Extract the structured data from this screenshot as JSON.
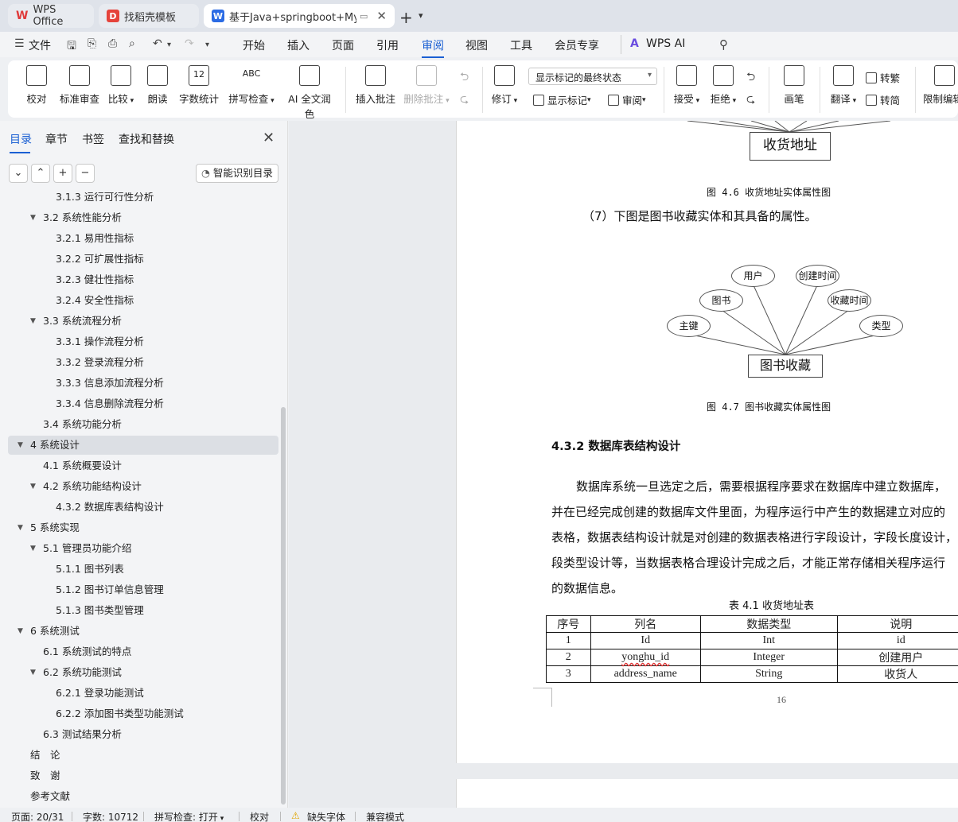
{
  "tabs": {
    "wps": "WPS Office",
    "template": "找稻壳模板",
    "document": "基于Java+springboot+MyS"
  },
  "menu": {
    "file": "文件",
    "items": [
      "开始",
      "插入",
      "页面",
      "引用",
      "审阅",
      "视图",
      "工具",
      "会员专享"
    ],
    "active": "审阅",
    "ai": "WPS AI"
  },
  "ribbon": {
    "proofread": "校对",
    "standard_review": "标准审查",
    "compare": "比较",
    "read_aloud": "朗读",
    "word_count": "字数统计",
    "spell_check": "拼写检查",
    "ai_polish": "AI 全文润色",
    "insert_comment": "插入批注",
    "delete_comment": "删除批注",
    "track_changes": "修订",
    "markup_mode": "显示标记的最终状态",
    "show_markup": "显示标记",
    "review": "审阅",
    "accept": "接受",
    "reject": "拒绝",
    "pen": "画笔",
    "translate": "翻译",
    "to_traditional": "转繁",
    "to_simplified": "转简",
    "restrict_edit": "限制编辑",
    "word_count_icon_text": "12",
    "spell_icon_text": "ABC"
  },
  "nav": {
    "tabs": [
      "目录",
      "章节",
      "书签",
      "查找和替换"
    ],
    "smart_toc": "智能识别目录",
    "toc": [
      {
        "label": "3.1.3 运行可行性分析",
        "level": 3
      },
      {
        "label": "3.2 系统性能分析",
        "level": 2,
        "expanded": true
      },
      {
        "label": "3.2.1 易用性指标",
        "level": 3
      },
      {
        "label": "3.2.2 可扩展性指标",
        "level": 3
      },
      {
        "label": "3.2.3 健壮性指标",
        "level": 3
      },
      {
        "label": "3.2.4 安全性指标",
        "level": 3
      },
      {
        "label": "3.3 系统流程分析",
        "level": 2,
        "expanded": true
      },
      {
        "label": "3.3.1 操作流程分析",
        "level": 3
      },
      {
        "label": "3.3.2 登录流程分析",
        "level": 3
      },
      {
        "label": "3.3.3 信息添加流程分析",
        "level": 3
      },
      {
        "label": "3.3.4 信息删除流程分析",
        "level": 3
      },
      {
        "label": "3.4 系统功能分析",
        "level": 2
      },
      {
        "label": "4 系统设计",
        "level": 1,
        "expanded": true,
        "selected": true
      },
      {
        "label": "4.1 系统概要设计",
        "level": 2
      },
      {
        "label": "4.2 系统功能结构设计",
        "level": 2,
        "expanded": true
      },
      {
        "label": "4.3.2 数据库表结构设计",
        "level": 3
      },
      {
        "label": "5 系统实现",
        "level": 1,
        "expanded": true
      },
      {
        "label": "5.1 管理员功能介绍",
        "level": 2,
        "expanded": true
      },
      {
        "label": "5.1.1 图书列表",
        "level": 3
      },
      {
        "label": "5.1.2 图书订单信息管理",
        "level": 3
      },
      {
        "label": "5.1.3 图书类型管理",
        "level": 3
      },
      {
        "label": "6 系统测试",
        "level": 1,
        "expanded": true
      },
      {
        "label": "6.1 系统测试的特点",
        "level": 2
      },
      {
        "label": "6.2 系统功能测试",
        "level": 2,
        "expanded": true
      },
      {
        "label": "6.2.1 登录功能测试",
        "level": 3
      },
      {
        "label": "6.2.2 添加图书类型功能测试",
        "level": 3
      },
      {
        "label": "6.3 测试结果分析",
        "level": 2
      },
      {
        "label": "结　论",
        "level": 1
      },
      {
        "label": "致　谢",
        "level": 1
      },
      {
        "label": "参考文献",
        "level": 1
      }
    ]
  },
  "document": {
    "entity_address": "收货地址",
    "fig_4_6": "图 4.6 收货地址实体属性图",
    "item7": "（7）下图是图书收藏实体和其具备的属性。",
    "entity_collect": "图书收藏",
    "attrs": [
      "用户",
      "创建时间",
      "图书",
      "收藏时间",
      "主键",
      "类型"
    ],
    "fig_4_7": "图 4.7 图书收藏实体属性图",
    "section_title": "4.3.2  数据库表结构设计",
    "paragraph_lines": [
      "数据库系统一旦选定之后，需要根据程序要求在数据库中建立数据库，",
      "并在已经完成创建的数据库文件里面，为程序运行中产生的数据建立对应的",
      "表格，数据表结构设计就是对创建的数据表格进行字段设计，字段长度设计，",
      "段类型设计等，当数据表格合理设计完成之后，才能正常存储相关程序运行",
      "的数据信息。"
    ],
    "table_title": "表 4.1 收货地址表",
    "table_header": [
      "序号",
      "列名",
      "数据类型",
      "说明"
    ],
    "table_rows": [
      [
        "1",
        "Id",
        "Int",
        "id"
      ],
      [
        "2",
        "yonghu_id",
        "Integer",
        "创建用户"
      ],
      [
        "3",
        "address_name",
        "String",
        "收货人"
      ]
    ],
    "page_number": "16"
  },
  "status": {
    "page": "页面: 20/31",
    "words": "字数: 10712",
    "spell": "拼写检查: 打开",
    "proof": "校对",
    "missing_font": "缺失字体",
    "compat": "兼容模式"
  }
}
